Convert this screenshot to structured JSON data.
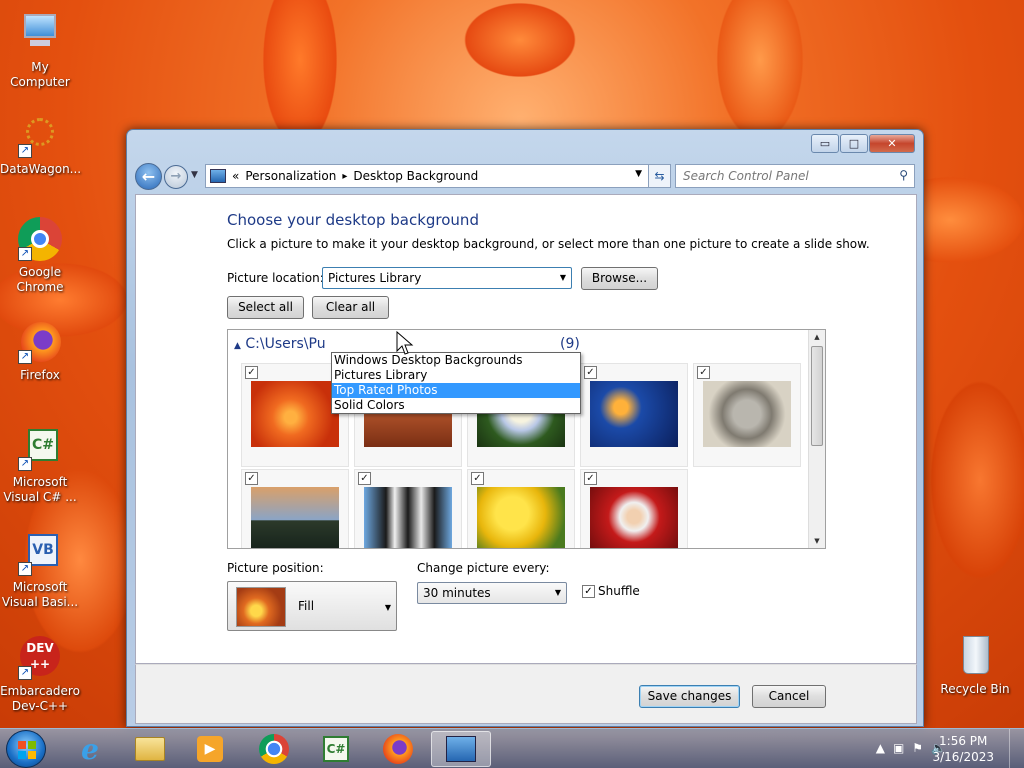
{
  "desktop": {
    "icons": [
      {
        "label": "My Computer"
      },
      {
        "label": "DataWagon..."
      },
      {
        "label": "Google Chrome"
      },
      {
        "label": "Firefox"
      },
      {
        "label": "Microsoft Visual C# ..."
      },
      {
        "label": "Microsoft Visual Basi..."
      },
      {
        "label": "Embarcadero Dev-C++"
      },
      {
        "label": "Recycle Bin"
      }
    ]
  },
  "window": {
    "controls": {
      "minimize": "▭",
      "maximize": "□",
      "close": "✕"
    },
    "address": {
      "chevron": "«",
      "crumbs": [
        "Personalization",
        "Desktop Background"
      ],
      "separator": "▸"
    },
    "search": {
      "placeholder": "Search Control Panel"
    },
    "heading": "Choose your desktop background",
    "description": "Click a picture to make it your desktop background, or select more than one picture to create a slide show.",
    "picture_location": {
      "label": "Picture location:",
      "value": "Pictures Library",
      "browse": "Browse...",
      "options": [
        "Windows Desktop Backgrounds",
        "Pictures Library",
        "Top Rated Photos",
        "Solid Colors"
      ],
      "highlighted": "Top Rated Photos"
    },
    "select_all": "Select all",
    "clear_all": "Clear all",
    "gallery": {
      "group_path": "C:\\Users\\Public\\Pictures\\Sample Pictures (9)",
      "group_visible_start": "C:\\Users\\Pu",
      "group_visible_end": "(9)",
      "items": [
        {
          "name": "Chrysanthemum",
          "checked": true
        },
        {
          "name": "Desert",
          "checked": true
        },
        {
          "name": "Hydrangeas",
          "checked": true
        },
        {
          "name": "Jellyfish",
          "checked": true
        },
        {
          "name": "Koala",
          "checked": true
        },
        {
          "name": "Lighthouse",
          "checked": true
        },
        {
          "name": "Penguins",
          "checked": true
        },
        {
          "name": "Tulips",
          "checked": true
        },
        {
          "name": "Santa",
          "checked": true
        }
      ]
    },
    "picture_position": {
      "label": "Picture position:",
      "value": "Fill"
    },
    "change_every": {
      "label": "Change picture every:",
      "value": "30 minutes"
    },
    "shuffle": {
      "label": "Shuffle",
      "checked": true
    },
    "save": "Save changes",
    "cancel": "Cancel"
  },
  "taskbar": {
    "clock_time": "1:56 PM",
    "clock_date": "3/16/2023",
    "pinned": [
      "Internet Explorer",
      "Windows Explorer",
      "Windows Media Player",
      "Google Chrome",
      "Visual C#",
      "Firefox",
      "Control Panel"
    ]
  }
}
